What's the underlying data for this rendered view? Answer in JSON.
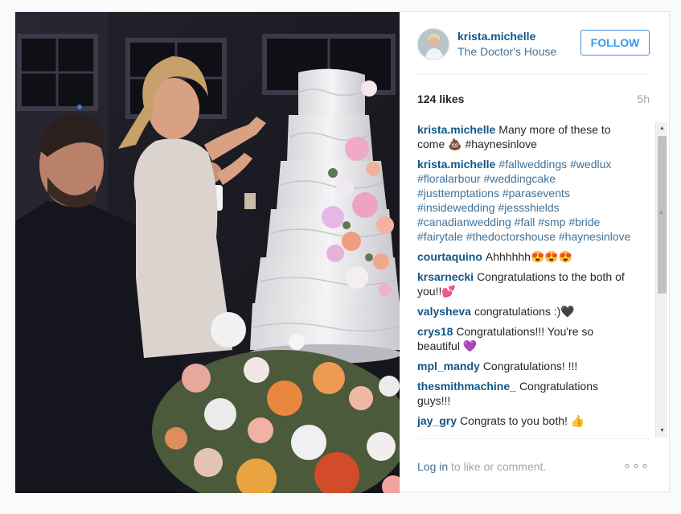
{
  "post": {
    "username": "krista.michelle",
    "location": "The Doctor's House",
    "follow_label": "FOLLOW",
    "likes": "124 likes",
    "age": "5h",
    "photo_alt": "Wedding cake cutting photo"
  },
  "comments": [
    {
      "user": "krista.michelle",
      "text": "Many more of these to come 💩 #haynesinlove"
    },
    {
      "user": "krista.michelle",
      "text": "#fallweddings #wedlux #floralarbour #weddingcake #justtemptations #parasevents #insidewedding #jessshields #canadianwedding #fall #smp #bride #fairytale #thedoctorshouse #haynesinlove"
    },
    {
      "user": "courtaquino",
      "text": "Ahhhhhh😍😍😍"
    },
    {
      "user": "krsarnecki",
      "text": "Congratulations to the both of you!!💕"
    },
    {
      "user": "valysheva",
      "text": "congratulations :)🖤"
    },
    {
      "user": "crys18",
      "text": "Congratulations!!! You're so beautiful 💜"
    },
    {
      "user": "mpl_mandy",
      "text": "Congratulations! !!!"
    },
    {
      "user": "thesmithmachine_",
      "text": "Congratulations guys!!!"
    },
    {
      "user": "jay_gry",
      "text": "Congrats to you both! 👍"
    }
  ],
  "footer": {
    "login_link": "Log in",
    "login_rest": " to like or comment.",
    "more_icon": "ellipsis-icon",
    "more_glyph": "∘∘∘"
  },
  "scrollbar": {
    "up_glyph": "▲",
    "down_glyph": "▼",
    "grip_glyph": "≡"
  }
}
